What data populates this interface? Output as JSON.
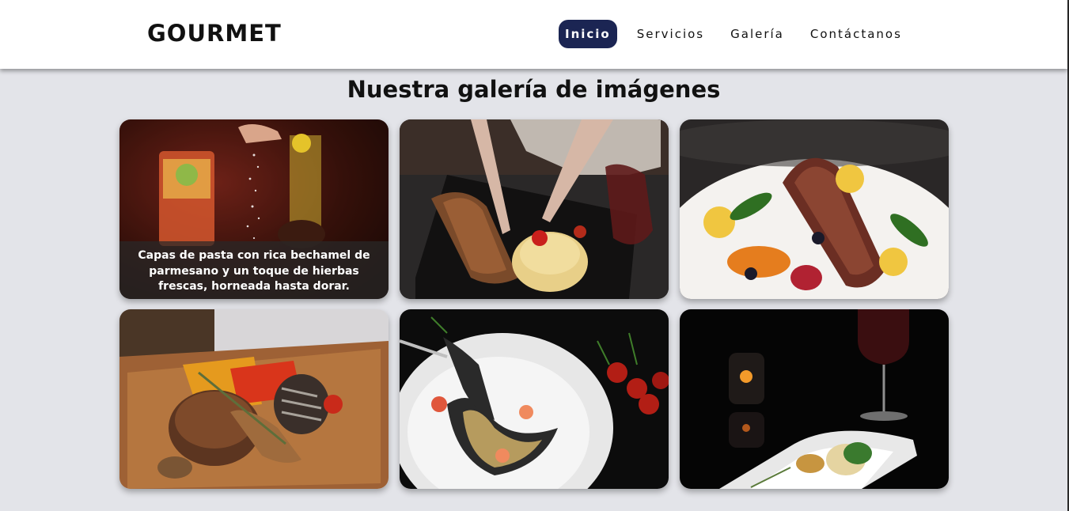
{
  "brand": {
    "logo": "GOURMET"
  },
  "nav": {
    "items": [
      {
        "label": "Inicio",
        "active": true
      },
      {
        "label": "Servicios",
        "active": false
      },
      {
        "label": "Galería",
        "active": false
      },
      {
        "label": "Contáctanos",
        "active": false
      }
    ]
  },
  "gallery": {
    "title": "Nuestra galería de imágenes",
    "cards": [
      {
        "image": "salt-sprinkle-cocktail-photo",
        "caption": "Capas de pasta con rica bechamel de parmesano y un toque de hierbas frescas, horneada hasta dorar."
      },
      {
        "image": "steak-mashed-potatoes-photo"
      },
      {
        "image": "duck-breast-vegetables-photo"
      },
      {
        "image": "grilled-steak-mushroom-sauce-photo"
      },
      {
        "image": "black-spaghetti-seafood-photo"
      },
      {
        "image": "plated-dish-wine-candles-photo"
      }
    ]
  },
  "colors": {
    "accent": "#1b2553",
    "background": "#e3e4e9"
  }
}
